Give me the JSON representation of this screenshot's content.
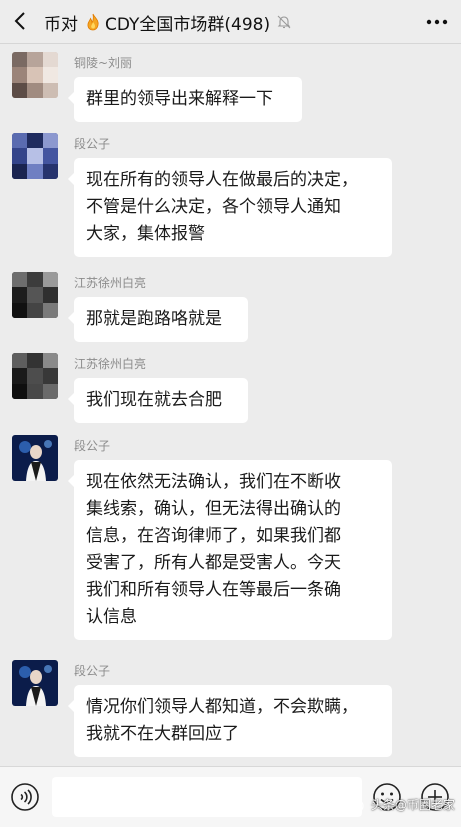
{
  "header": {
    "title_prefix": "币对",
    "title_main": "CDY全国市场群(498)",
    "back_icon": "chevron-left-icon",
    "fire_icon": "fire-emoji-icon",
    "mute_icon": "muted-bell-icon",
    "more_icon": "more-dots-icon"
  },
  "messages": [
    {
      "sender": "铜陵~刘丽",
      "text": "群里的领导出来解释一下"
    },
    {
      "sender": "段公子",
      "text": "现在所有的领导人在做最后的决定，\n不管是什么决定，各个领导人通知\n大家，集体报警"
    },
    {
      "sender": "江苏徐州白亮",
      "text": "那就是跑路咯就是"
    },
    {
      "sender": "江苏徐州白亮",
      "text": "我们现在就去合肥"
    },
    {
      "sender": "段公子",
      "text": "现在依然无法确认，我们在不断收\n集线索，确认，但无法得出确认的\n信息，在咨询律师了，如果我们都\n受害了，所有人都是受害人。今天\n我们和所有领导人在等最后一条确\n认信息"
    },
    {
      "sender": "段公子",
      "text": "情况你们领导人都知道，不会欺瞒，\n我就不在大群回应了"
    }
  ],
  "bottombar": {
    "voice_icon": "voice-icon",
    "emoji_icon": "emoji-icon",
    "plus_icon": "plus-icon"
  },
  "watermark": "头条@币圈老家",
  "colors": {
    "background": "#ececec",
    "bubble": "#ffffff",
    "sender_text": "#8c8c8c"
  }
}
